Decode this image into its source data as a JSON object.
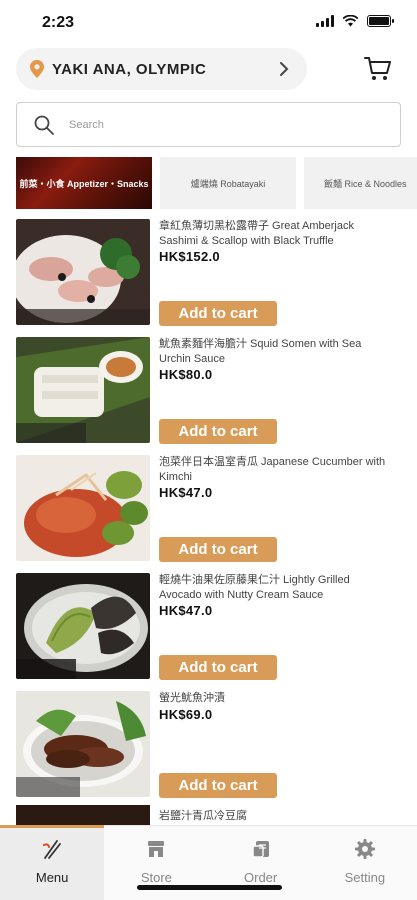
{
  "status_bar": {
    "time": "2:23"
  },
  "header": {
    "location": "YAKI ANA, OLYMPIC",
    "location_icon": "location-pin-icon",
    "cart_icon": "cart-icon"
  },
  "search": {
    "placeholder": "Search",
    "icon": "search-icon"
  },
  "categories": [
    {
      "label": "前菜・小食 Appetizer・Snacks",
      "active": true
    },
    {
      "label": "爐端燒 Robatayaki",
      "active": false
    },
    {
      "label": "飯麵 Rice & Noodles",
      "active": false
    }
  ],
  "menu_items": [
    {
      "name": "章紅魚薄切黑松露帶子 Great Amberjack Sashimi & Scallop with Black Truffle",
      "price": "HK$152.0",
      "button": "Add to cart"
    },
    {
      "name": "魷魚素麵伴海膽汁 Squid Somen with Sea Urchin Sauce",
      "price": "HK$80.0",
      "button": "Add to cart"
    },
    {
      "name": "泡菜伴日本温室青瓜 Japanese Cucumber with Kimchi",
      "price": "HK$47.0",
      "button": "Add to cart"
    },
    {
      "name": "輕燒牛油果佐原藤果仁汁 Lightly Grilled Avocado with Nutty Cream Sauce",
      "price": "HK$47.0",
      "button": "Add to cart"
    },
    {
      "name": "螢光魷魚沖漬",
      "price": "HK$69.0",
      "button": "Add to cart"
    }
  ],
  "partial_item": {
    "name": "岩鹽汁青瓜冷豆腐"
  },
  "tab_bar": {
    "tabs": [
      {
        "label": "Menu",
        "icon": "chopsticks-icon",
        "active": true
      },
      {
        "label": "Store",
        "icon": "store-icon",
        "active": false
      },
      {
        "label": "Order",
        "icon": "order-icon",
        "active": false
      },
      {
        "label": "Setting",
        "icon": "gear-icon",
        "active": false
      }
    ]
  },
  "colors": {
    "accent": "#d99c58",
    "brand_location": "#e8964a"
  }
}
